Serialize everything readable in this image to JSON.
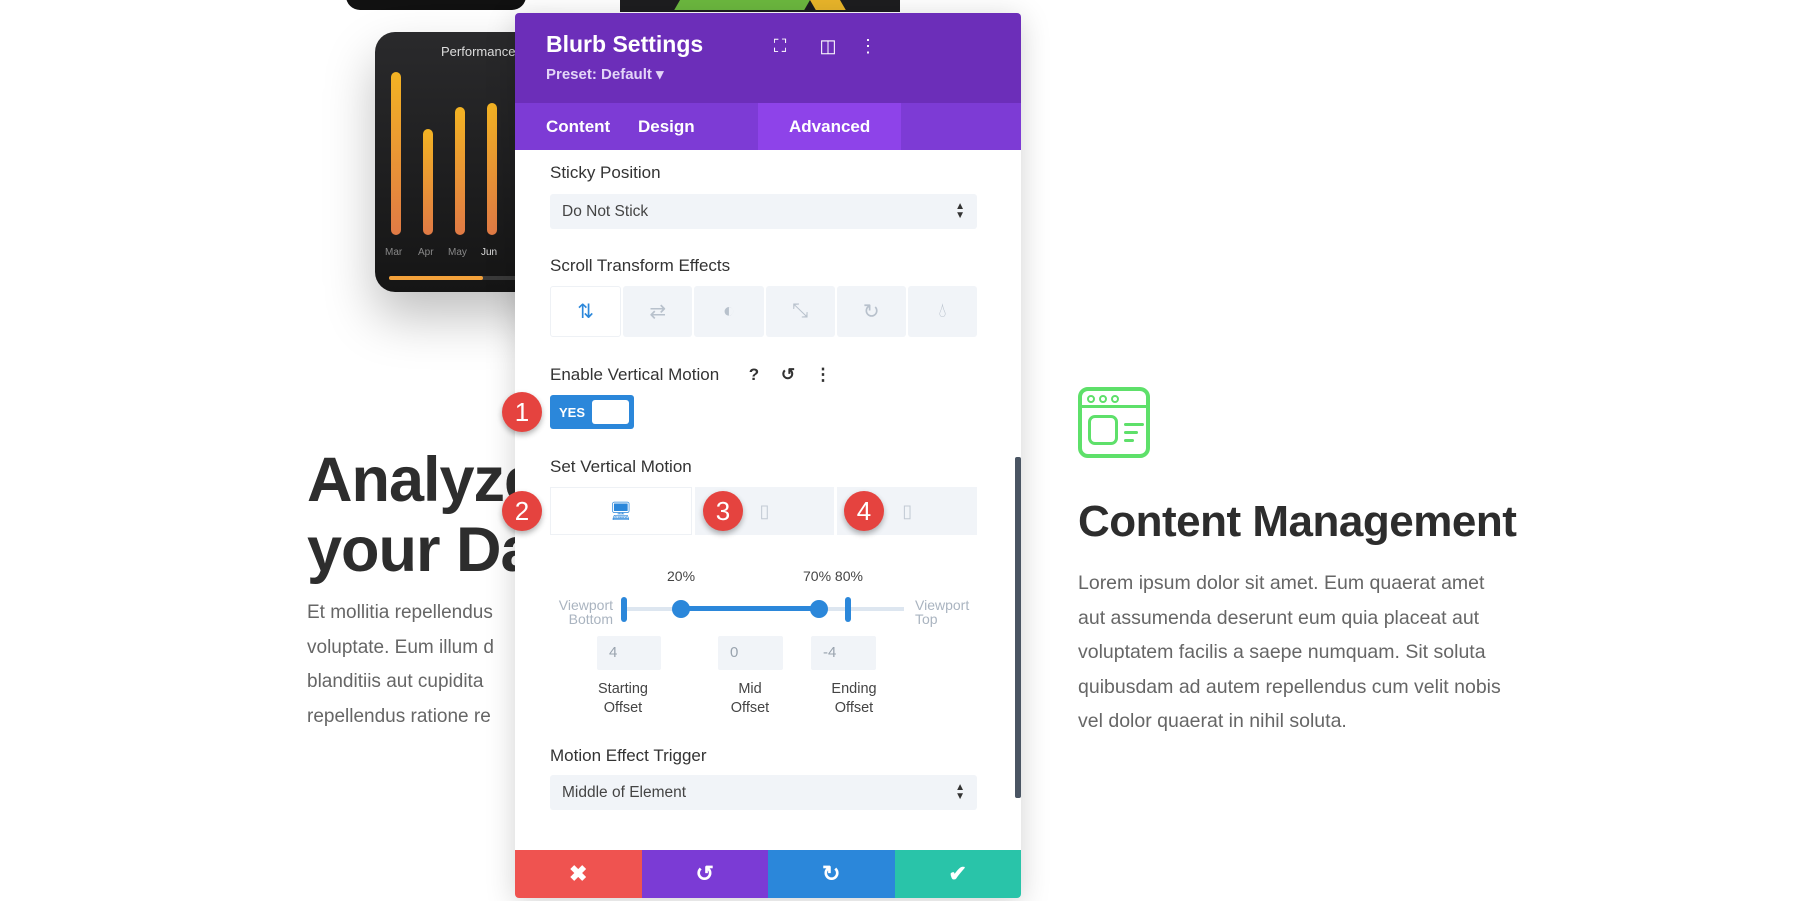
{
  "background": {
    "phone_card": {
      "title": "Performance",
      "months": [
        "Mar",
        "Apr",
        "May",
        "Jun"
      ],
      "bar_levels": [
        0.9,
        0.62,
        0.78,
        0.8
      ],
      "progress": 0.52
    },
    "left": {
      "heading_line1": "Analyze",
      "heading_line2": "your Da",
      "paragraph_lines": [
        "Et mollitia repellendus",
        "voluptate. Eum illum d",
        "blanditiis aut cupidita",
        "repellendus ratione re"
      ]
    },
    "right": {
      "icon": "browser-window-icon",
      "heading": "Content Management",
      "paragraph_lines": [
        "Lorem ipsum dolor sit amet. Eum quaerat amet",
        "aut assumenda deserunt eum quia placeat aut",
        "voluptatem facilis a saepe numquam. Sit soluta",
        "quibusdam ad autem repellendus cum velit nobis",
        "vel dolor quaerat in nihil soluta."
      ],
      "accent": "#5ee06a"
    }
  },
  "panel": {
    "title": "Blurb Settings",
    "preset": "Preset: Default ▾",
    "header_icons": [
      "fullscreen-icon",
      "split-view-icon",
      "more-vertical-icon"
    ],
    "tabs": [
      {
        "label": "Content"
      },
      {
        "label": "Design"
      },
      {
        "label": "Advanced",
        "active": true
      }
    ],
    "sticky": {
      "label": "Sticky Position",
      "value": "Do Not Stick"
    },
    "scroll_effects": {
      "label": "Scroll Transform Effects",
      "icons": [
        "vertical-motion-icon",
        "horizontal-motion-icon",
        "fading-icon",
        "scaling-icon",
        "rotating-icon",
        "blur-icon"
      ],
      "active": 0
    },
    "enable_vertical": {
      "label": "Enable Vertical Motion",
      "toggle": "YES",
      "enabled": true
    },
    "set_vertical": {
      "label": "Set Vertical Motion",
      "devices": [
        "desktop-icon",
        "tablet-icon",
        "phone-icon"
      ],
      "active_device": 0,
      "slider": {
        "start": 20,
        "mid_start": 70,
        "end": 80,
        "start_label": "20%",
        "end_label": "70% 80%",
        "left_label": "Viewport Bottom",
        "right_label": "Viewport Top"
      },
      "offsets": [
        {
          "value": "4",
          "label1": "Starting",
          "label2": "Offset"
        },
        {
          "value": "0",
          "label1": "Mid",
          "label2": "Offset"
        },
        {
          "value": "-4",
          "label1": "Ending",
          "label2": "Offset"
        }
      ]
    },
    "trigger": {
      "label": "Motion Effect Trigger",
      "value": "Middle of Element"
    },
    "footer": {
      "cancel": "✖",
      "undo": "↺",
      "redo": "↻",
      "save": "✔",
      "colors": [
        "#ef5350",
        "#7b3bd5",
        "#2b87da",
        "#29c4a9"
      ]
    }
  },
  "badges": [
    "1",
    "2",
    "3",
    "4"
  ]
}
